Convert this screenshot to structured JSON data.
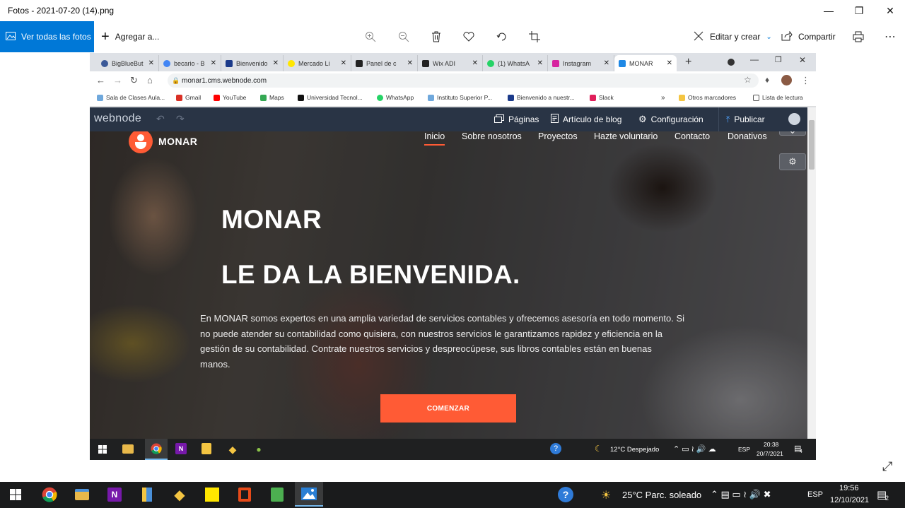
{
  "photos": {
    "title": "Fotos - 2021-07-20 (14).png",
    "ver_todas": "Ver todas las fotos",
    "agregar": "Agregar a...",
    "editar": "Editar y crear",
    "compartir": "Compartir"
  },
  "browser": {
    "tabs": [
      {
        "label": "BigBlueBut",
        "color": "#3b5998"
      },
      {
        "label": "becario - B",
        "color": "#4285f4"
      },
      {
        "label": "Bienvenido",
        "color": "#1b3a8a"
      },
      {
        "label": "Mercado Li",
        "color": "#ffe600"
      },
      {
        "label": "Panel de c",
        "color": "#222222"
      },
      {
        "label": "Wix ADI",
        "color": "#222222"
      },
      {
        "label": "(1) WhatsA",
        "color": "#25d366"
      },
      {
        "label": "Instagram",
        "color": "#d6249f"
      },
      {
        "label": "MONAR",
        "color": "#1e88e5"
      }
    ],
    "url": "monar1.cms.webnode.com",
    "bookmarks": [
      "Sala de Clases Aula...",
      "Gmail",
      "YouTube",
      "Maps",
      "Universidad Tecnol...",
      "WhatsApp",
      "Instituto Superior P...",
      "Bienvenido a nuestr...",
      "Slack",
      "Otros marcadores",
      "Lista de lectura"
    ]
  },
  "webnode": {
    "logo": "webnode",
    "paginas": "Páginas",
    "articulo": "Artículo de blog",
    "configuracion": "Configuración",
    "publicar": "Publicar"
  },
  "site": {
    "brand": "MONAR",
    "nav": [
      "Inicio",
      "Sobre nosotros",
      "Proyectos",
      "Hazte voluntario",
      "Contacto",
      "Donativos"
    ],
    "heading1": "MONAR",
    "heading2": "LE DA LA BIENVENIDA.",
    "intro_lines": [
      "En MONAR somos expertos en una amplia variedad de servicios contables y ofrecemos asesoría en todo momento. Si",
      "no puede atender su contabilidad como quisiera, con nuestros servicios le garantizamos rapidez y eficiencia en la",
      "gestión de su contabilidad. Contrate nuestros servicios y despreocúpese, sus libros contables están en buenas",
      "manos."
    ],
    "cta": "COMENZAR"
  },
  "inner_taskbar": {
    "weather": "12°C  Despejado",
    "lang": "ESP",
    "time": "20:38",
    "date": "20/7/2021",
    "notif": "4"
  },
  "taskbar": {
    "weather": "25°C  Parc. soleado",
    "lang": "ESP",
    "time": "19:56",
    "date": "12/10/2021",
    "notif": "2"
  }
}
